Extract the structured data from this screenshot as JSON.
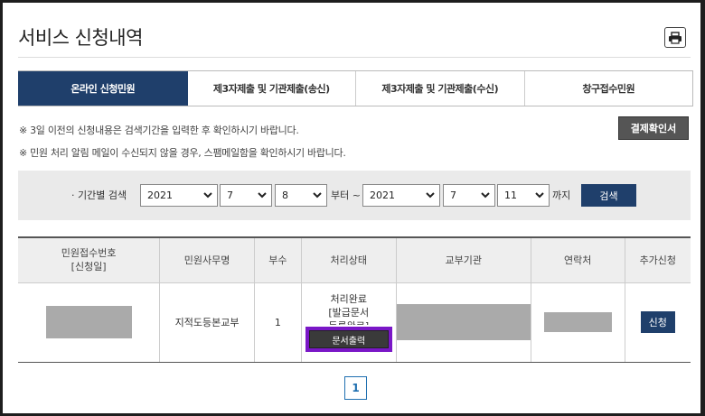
{
  "page": {
    "title": "서비스 신청내역"
  },
  "tabs": [
    {
      "label": "온라인 신청민원",
      "active": true
    },
    {
      "label": "제3자제출 및 기관제출(송신)",
      "active": false
    },
    {
      "label": "제3자제출 및 기관제출(수신)",
      "active": false
    },
    {
      "label": "창구접수민원",
      "active": false
    }
  ],
  "notices": {
    "line1": "※ 3일 이전의 신청내용은 검색기간을 입력한 후 확인하시기 바랍니다.",
    "line2": "※ 민원 처리 알림 메일이 수신되지 않을 경우, 스팸메일함을 확인하시기 바랍니다."
  },
  "payment_button": "결제확인서",
  "search": {
    "label": "· 기간별 검색",
    "from": {
      "year": "2021",
      "month": "7",
      "day": "8"
    },
    "from_suffix": "부터 ~",
    "to": {
      "year": "2021",
      "month": "7",
      "day": "11"
    },
    "to_suffix": "까지",
    "button": "검색"
  },
  "table": {
    "headers": {
      "receipt_no_line1": "민원접수번호",
      "receipt_no_line2": "[신청일]",
      "service_name": "민원사무명",
      "copies": "부수",
      "status": "처리상태",
      "issuer": "교부기관",
      "contact": "연락처",
      "extra": "추가신청"
    },
    "rows": [
      {
        "service_name": "지적도등본교부",
        "copies": "1",
        "status_line1": "처리완료",
        "status_line2": "[발급문서",
        "status_line3": "등록완료]",
        "print_button": "문서출력",
        "apply_button": "신청"
      }
    ]
  },
  "pagination": {
    "current": "1"
  },
  "colors": {
    "primary": "#1f3f6b",
    "highlight": "#7a17c7",
    "redaction": "#aaaaaa"
  },
  "icons": {
    "print": "printer-icon",
    "select": "chevron-down-icon"
  }
}
